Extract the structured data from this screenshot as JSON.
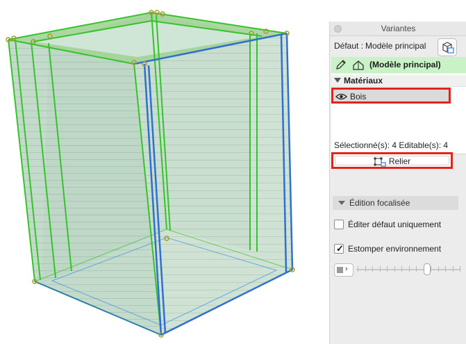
{
  "panel": {
    "title": "Variantes",
    "default_label": "Défaut :",
    "default_value": "Modèle principal",
    "model_name": "(Modèle principal)",
    "section_title": "Matériaux",
    "material_item": "Bois",
    "selected_info": "Sélectionné(s): 4 Editable(s): 4",
    "relier_label": "Relier",
    "focus_title": "Édition focalisée",
    "check_edit_default": {
      "label": "Éditer défaut uniquement",
      "checked": false
    },
    "check_fade_env": {
      "label": "Estomper environnement",
      "checked": true
    },
    "check_mark": "✓",
    "slider_chevron": "›",
    "fade_level": 0.69
  },
  "icons": {
    "close": "close-icon",
    "cube_link": "cube-link-icon",
    "pencil": "pencil-icon",
    "house": "house-icon",
    "eye": "eye-icon",
    "link_node": "link-node-icon",
    "triangle_down": "triangle-down-icon"
  },
  "colors": {
    "model_bar": "#c9f3c6",
    "highlight": "#e2231a",
    "edge_green": "#35c32c",
    "edge_blue": "#2f6fcf",
    "vertex": "#a89a32"
  }
}
